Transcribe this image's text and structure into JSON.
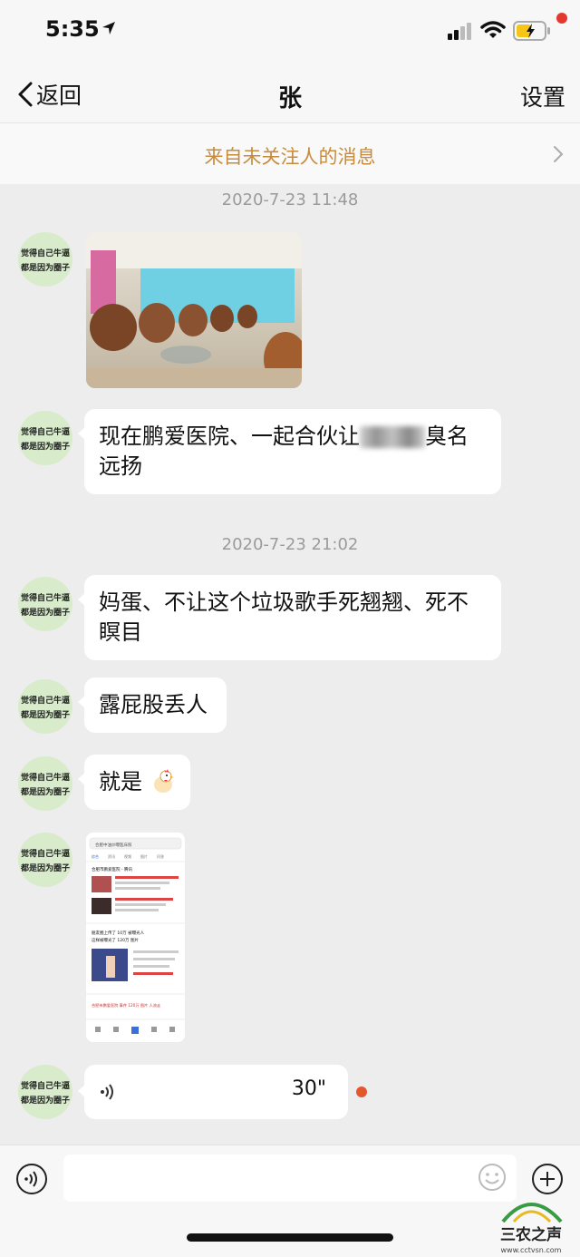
{
  "status_bar": {
    "time": "5:35"
  },
  "nav": {
    "back_label": "返回",
    "title": "张",
    "settings_label": "设置"
  },
  "banner": {
    "text": "来自未关注人的消息"
  },
  "messages": {
    "timestamp_1": "2020-7-23 11:48",
    "text_1_line1": "现在鹏爱医院、一起合伙让",
    "text_1_line1_end": "臭名",
    "text_1_line2": "远扬",
    "timestamp_2": "2020-7-23 21:02",
    "text_2_line1": "妈蛋、不让这个垃圾歌手死翘翘、死不",
    "text_2_line2": "瞑目",
    "text_3": "露屁股丢人",
    "text_4": "就是",
    "voice_duration": "30\""
  },
  "screenshot_card": {
    "search_text": "合肥中油炒曝医床照",
    "tabs": [
      "综合",
      "资讯",
      "视频",
      "图片",
      "问答"
    ],
    "headline_1": "合肥市鹏爱医院 - 腾讯",
    "headline_2": "朋友圈上传了 10万 被曝光人",
    "headline_3": "这样被曝光了 120万 图片",
    "footer": "合肥市鹏爱医院 事件 120万 图片 人流走"
  },
  "avatar": {
    "line1": "觉得自己牛逼",
    "line2": "都是因为圈子"
  },
  "watermark": {
    "text": "三农之声",
    "url": "www.cctvsn.com"
  },
  "colors": {
    "background": "#ededed",
    "banner_text": "#c68c3c",
    "unread": "#e4572e"
  }
}
